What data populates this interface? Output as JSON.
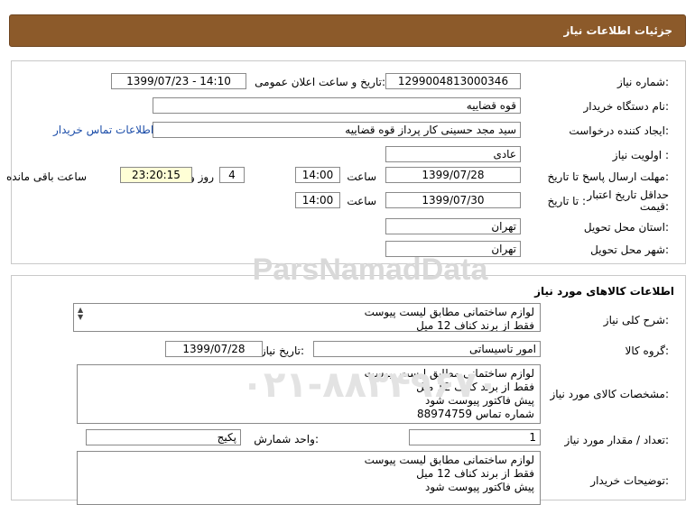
{
  "header": {
    "title": "جزئیات اطلاعات نیاز"
  },
  "details": {
    "need_number_label": "شماره نیاز:",
    "need_number": "1299004813000346",
    "announce_label": "تاریخ و ساعت اعلان عمومی:",
    "announce_value": "1399/07/23 - 14:10",
    "buyer_org_label": "نام دستگاه خریدار:",
    "buyer_org": "قوه قضاییه",
    "requester_label": "ایجاد کننده درخواست:",
    "requester": "سید مجد حسینی کار پرداز  قوه قضاییه",
    "contact_link": "اطلاعات تماس خریدار",
    "priority_label": "اولویت نیاز :",
    "priority": "عادی",
    "reply_deadline_label": "مهلت ارسال پاسخ:",
    "to_date_label": "تا تاریخ :",
    "reply_date": "1399/07/28",
    "time_label": "ساعت",
    "reply_time": "14:00",
    "days_value": "4",
    "days_label": "روز و",
    "remaining_time": "23:20:15",
    "remaining_label": "ساعت باقی مانده",
    "validity_label": "حداقل تاریخ اعتبار قیمت:",
    "validity_to_label": "تا تاریخ :",
    "validity_date": "1399/07/30",
    "validity_time_label": "ساعت",
    "validity_time": "14:00",
    "province_label": "استان محل تحویل:",
    "province": "تهران",
    "city_label": "شهر محل تحویل:",
    "city": "تهران"
  },
  "goods": {
    "section_title": "اطلاعات کالاهای مورد نیاز",
    "summary_label": "شرح کلی نیاز:",
    "summary_lines": [
      "لوازم ساختمانی مطابق لیست پیوست",
      "فقط از برند کناف 12 میل"
    ],
    "group_label": "گروه کالا:",
    "group_value": "امور تاسیساتی",
    "need_date_label": "تاریخ نیاز به کالا:",
    "need_date": "1399/07/28",
    "specs_label": "مشخصات کالای مورد نیاز:",
    "specs_lines": [
      "لوازم ساختمانی مطابق لیست پیوست",
      "فقط از برند کناف 12 میل",
      "پیش فاکتور پیوست شود",
      "شماره تماس 88974759"
    ],
    "qty_label": "تعداد / مقدار مورد نیاز:",
    "qty_value": "1",
    "unit_label": "واحد شمارش:",
    "unit_value": "پکیج",
    "buyer_notes_label": "توضیحات خریدار:",
    "buyer_notes_lines": [
      "لوازم ساختمانی مطابق لیست پیوست",
      "فقط از برند کناف 12 میل",
      "پیش فاکتور پیوست شود"
    ]
  },
  "watermark": {
    "brand": "ParsNamadData",
    "phone": "۰۲۱-۸۸۳۴۹۶۷۰"
  }
}
